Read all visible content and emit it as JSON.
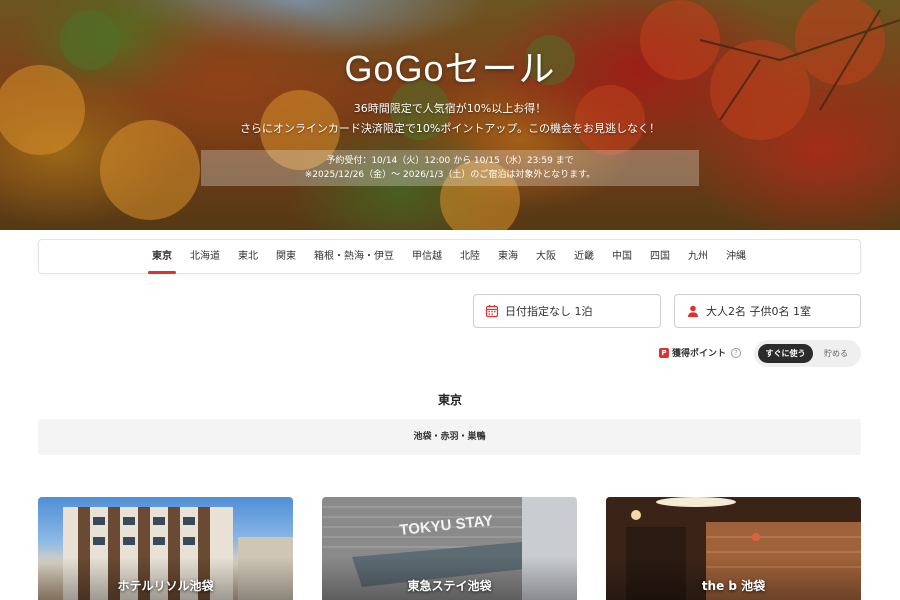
{
  "hero": {
    "title": "GoGoセール",
    "subtitle_line1": "36時間限定で人気宿が10%以上お得！",
    "subtitle_line2": "さらにオンラインカード決済限定で10%ポイントアップ。この機会をお見逃しなく！",
    "notice_line1": "予約受付：10/14（火）12:00 から 10/15（水）23:59 まで",
    "notice_line2": "※2025/12/26（金）〜 2026/1/3（土）のご宿泊は対象外となります。"
  },
  "regions": {
    "active_index": 0,
    "items": [
      "東京",
      "北海道",
      "東北",
      "関東",
      "箱根・熱海・伊豆",
      "甲信越",
      "北陸",
      "東海",
      "大阪",
      "近畿",
      "中国",
      "四国",
      "九州",
      "沖縄"
    ]
  },
  "search": {
    "date_label": "日付指定なし 1泊",
    "guests_label": "大人2名 子供0名 1室"
  },
  "points": {
    "badge": "P",
    "label": "獲得ポイント",
    "help": "?",
    "option_now": "すぐに使う",
    "option_save": "貯める"
  },
  "area": {
    "title": "東京",
    "subarea": "池袋・赤羽・巣鴨"
  },
  "hotels": [
    {
      "name": "ホテルリソル池袋"
    },
    {
      "name": "東急ステイ池袋"
    },
    {
      "name": "the b 池袋"
    }
  ],
  "colors": {
    "accent": "#e0312f",
    "toggle_active": "#2b2b2b"
  },
  "icons": {
    "date": "calendar-icon",
    "guests": "person-icon"
  }
}
